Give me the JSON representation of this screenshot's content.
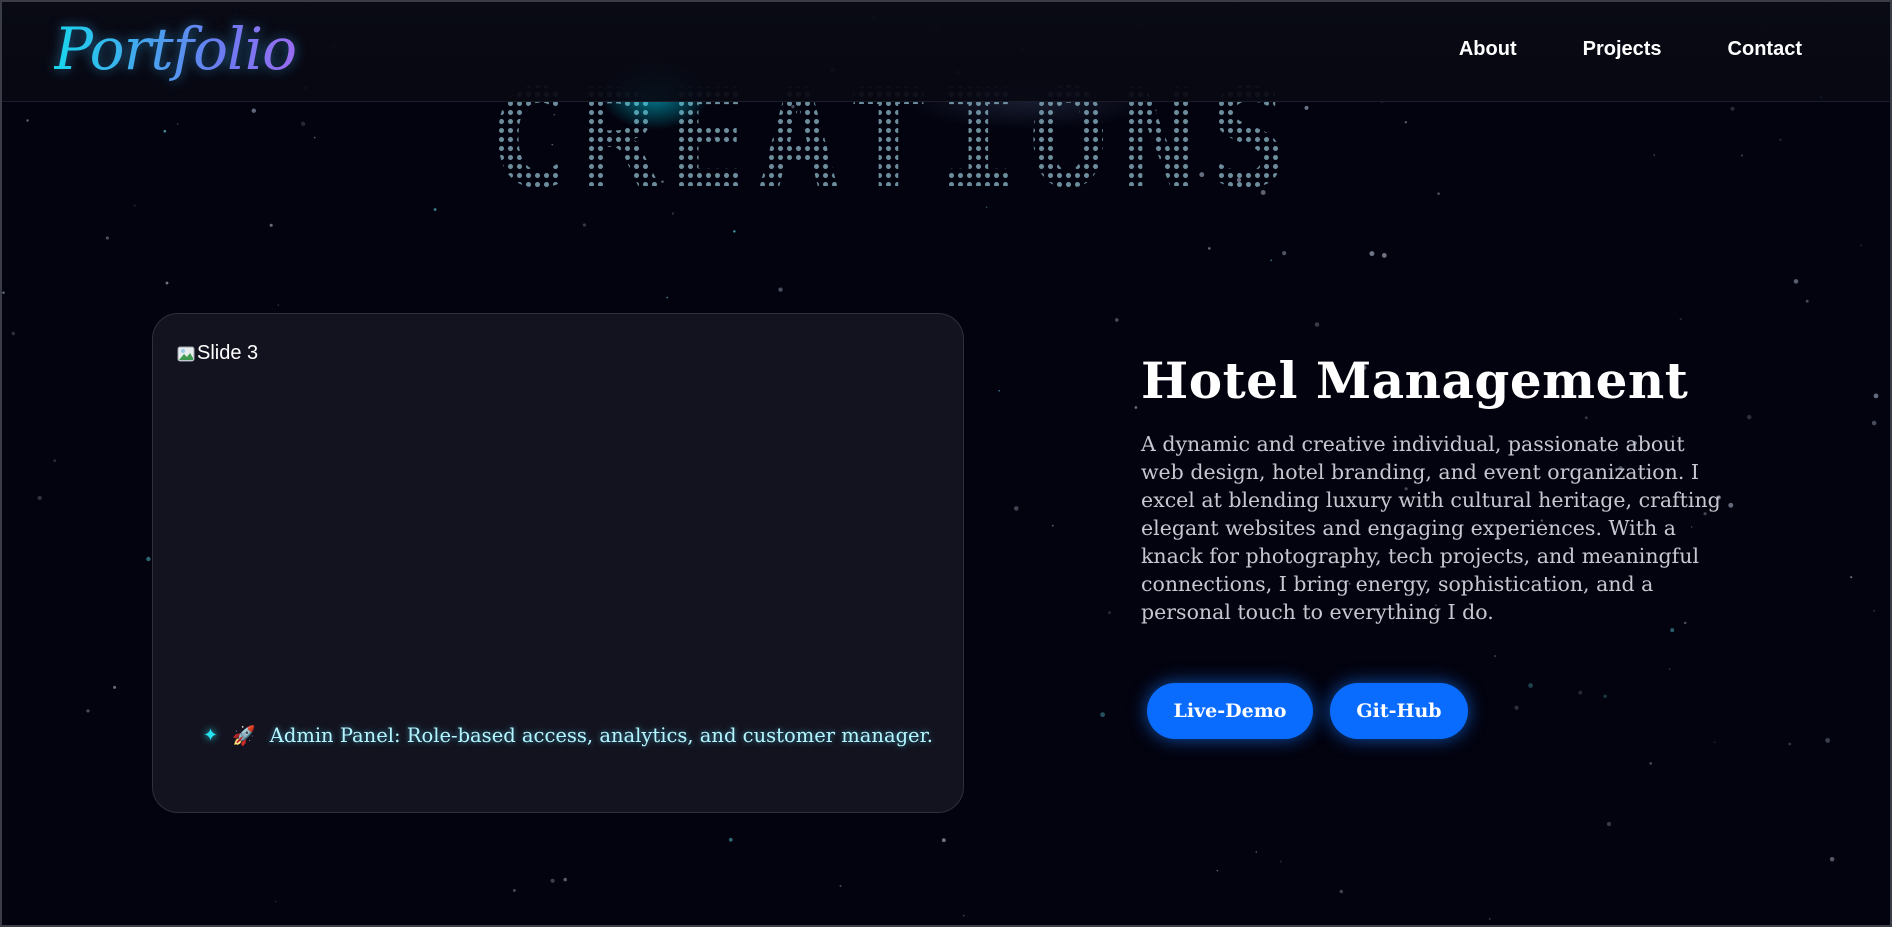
{
  "colors": {
    "background": "#03030f",
    "accent_blue": "#0a6cff",
    "feature_cyan": "#b4f6ff",
    "card": "#13131f"
  },
  "navbar": {
    "logo": "Portfolio",
    "links": [
      "About",
      "Projects",
      "Contact"
    ]
  },
  "section": {
    "background_title": "CREATIONS"
  },
  "slide": {
    "image_alt": "Slide 3",
    "image_icon": "broken-image-icon",
    "feature_icon": "sparkle-icon",
    "feature_emoji": "🚀",
    "feature_text": "Admin Panel: Role-based access, analytics, and customer manager."
  },
  "project": {
    "title": "Hotel Management",
    "description": "A dynamic and creative individual, passionate about web design, hotel branding, and event organization. I excel at blending luxury with cultural heritage, crafting elegant websites and engaging experiences. With a knack for photography, tech projects, and meaningful connections, I bring energy, sophistication, and a personal touch to everything I do.",
    "buttons": {
      "demo": "Live-Demo",
      "git": "Git-Hub"
    }
  }
}
